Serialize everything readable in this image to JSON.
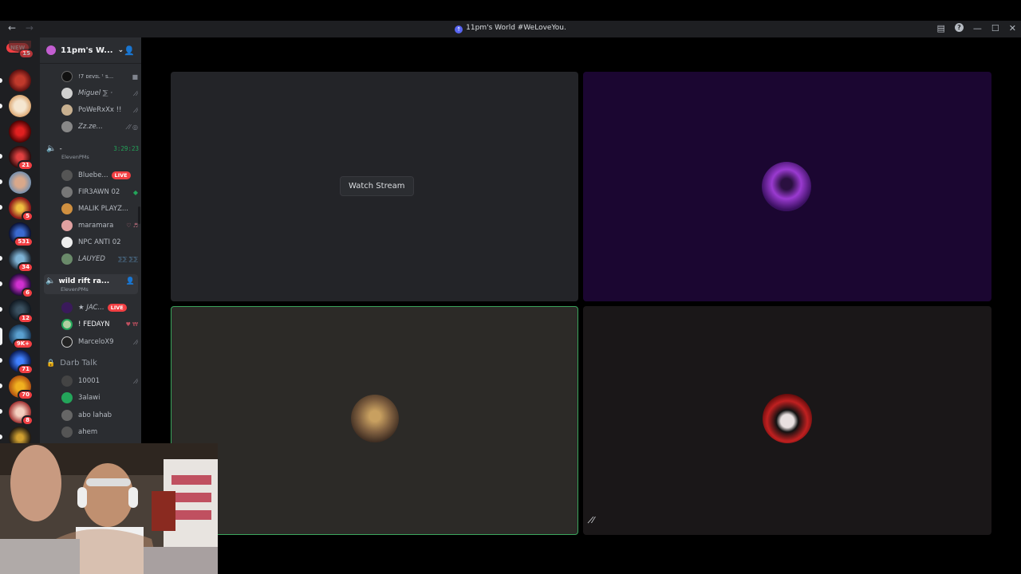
{
  "window": {
    "title": "11pm's World #WeLoveYou.",
    "back_icon": "arrow-left-icon",
    "forward_icon": "arrow-right-icon"
  },
  "server_rail": {
    "new_label": "NEW",
    "badges": [
      "15",
      "21",
      "5",
      "531",
      "34",
      "6",
      "12",
      "9K+",
      "71",
      "70",
      "8"
    ]
  },
  "channel_sidebar": {
    "server_name": "11pm's W...",
    "top_users": [
      {
        "name": "!7 ᴅᴇᴠɪʟ ᵗ s...",
        "status": "camera-icon"
      },
      {
        "name": "Miguel  ⅀ ·",
        "status": "mic-muted-icon"
      },
      {
        "name": "PoWeRxXx !!",
        "status": "mic-muted-icon"
      },
      {
        "name": "Zz.ze...",
        "status": "deafened-icon"
      }
    ],
    "vc1": {
      "name": "-",
      "timer": "3:29:23",
      "sub": "ElevenPMs",
      "users": [
        {
          "name": "Bluebe...",
          "live": "LIVE"
        },
        {
          "name": "FIR3AWN 02",
          "extra": "◆"
        },
        {
          "name": "MALIK PLAYZ...",
          "extra": ""
        },
        {
          "name": "maramara",
          "extra": "♡ ♬"
        },
        {
          "name": "NPC ANTI 02",
          "extra": ""
        },
        {
          "name": "LAUYED",
          "extra": "⅀⅀ ⅀⅀"
        }
      ]
    },
    "vc2": {
      "name": "wild rift ra...",
      "sub": "ElevenPMs",
      "users": [
        {
          "name": "★ JAC...",
          "live": "LIVE"
        },
        {
          "name": "! FEDAYN",
          "extra": "♥ ₩"
        },
        {
          "name": "MarceloX9",
          "extra": "mic-muted-icon"
        }
      ]
    },
    "vc3": {
      "name": "Darb Talk",
      "users": [
        {
          "name": "10001",
          "extra": "mic-muted-icon"
        },
        {
          "name": "3alawi",
          "extra": ""
        },
        {
          "name": "abo lahab",
          "extra": ""
        },
        {
          "name": "ahem",
          "extra": ""
        }
      ]
    }
  },
  "stage": {
    "watch_stream_label": "Watch Stream"
  },
  "colors": {
    "accent_green": "#23a55a",
    "live_red": "#f23f43",
    "blurple": "#5865f2"
  }
}
